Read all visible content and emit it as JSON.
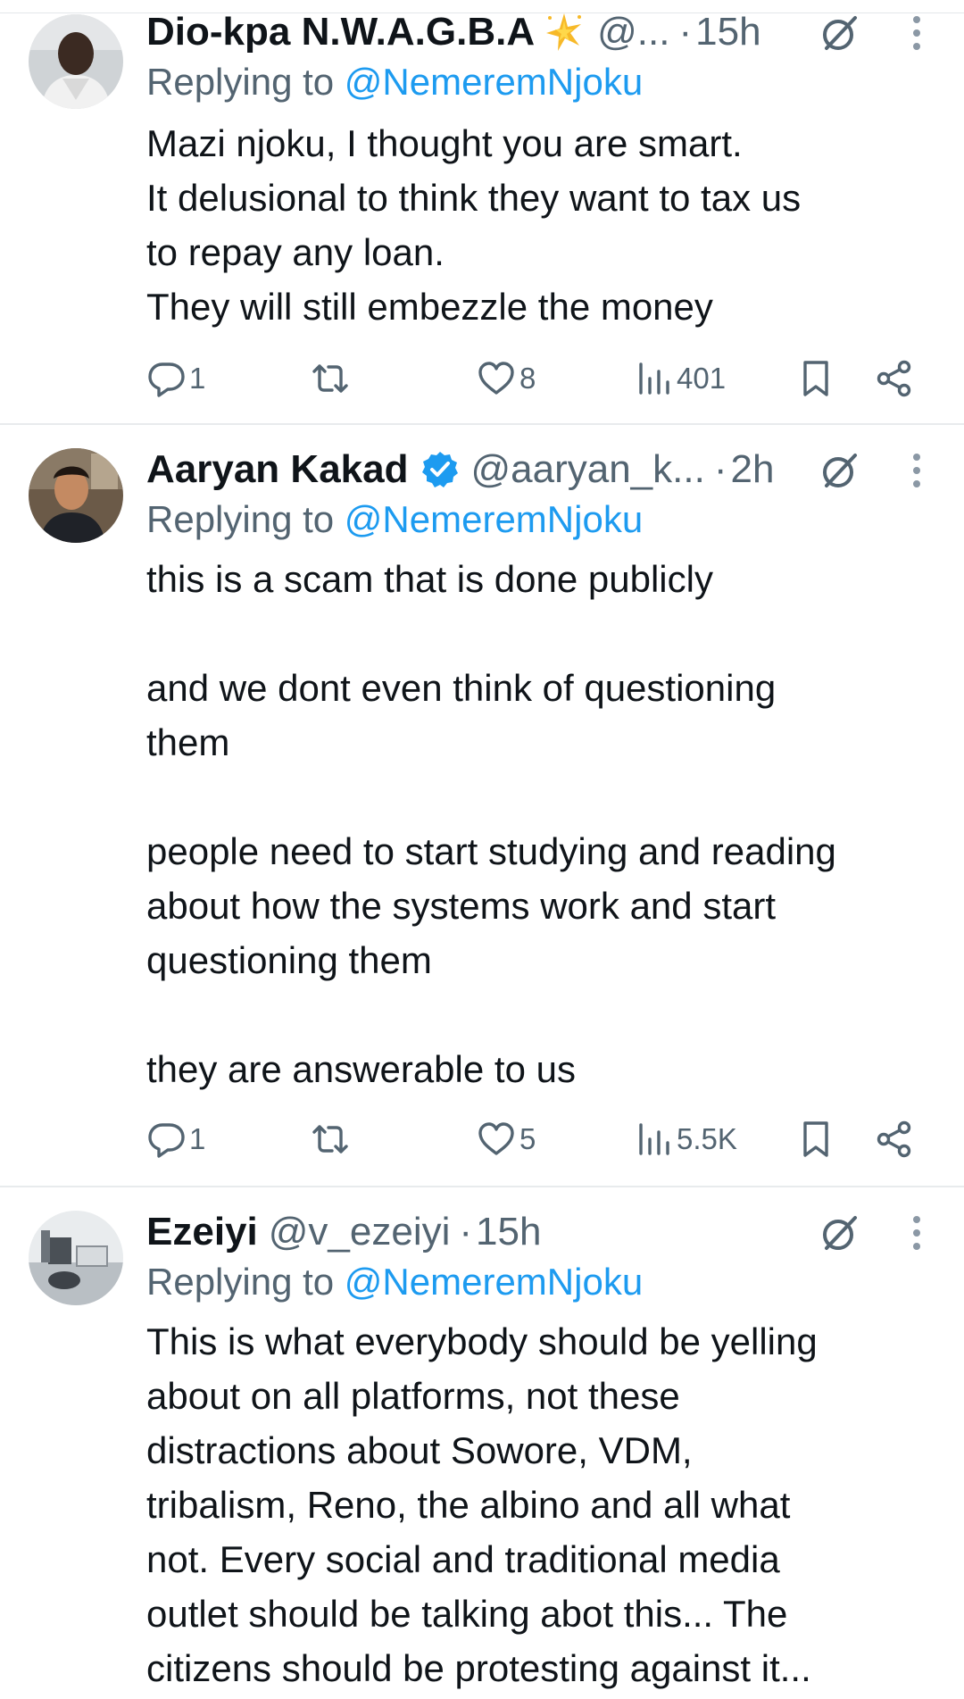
{
  "replies": [
    {
      "name": "Dio-kpa N.W.A.G.B.A",
      "name_emoji": "sparkle-star",
      "verified": false,
      "handle": "@...",
      "time": "15h",
      "replying_prefix": "Replying to",
      "replying_to": "@NemeremNjoku",
      "lines": [
        "Mazi njoku, I thought you are smart.",
        "It delusional to think they want to tax us",
        "to repay any loan.",
        "They will still embezzle the money"
      ],
      "stats": {
        "replies": "1",
        "reposts": "",
        "likes": "8",
        "views": "401"
      }
    },
    {
      "name": "Aaryan Kakad",
      "verified": true,
      "handle": "@aaryan_k...",
      "time": "2h",
      "replying_prefix": "Replying to",
      "replying_to": "@NemeremNjoku",
      "lines": [
        "this is a scam that is done publicly",
        "",
        "and we dont even think of questioning",
        "them",
        "",
        "people need to start studying and reading",
        "about how the systems work and start",
        "questioning them",
        "",
        "they are answerable to us"
      ],
      "stats": {
        "replies": "1",
        "reposts": "",
        "likes": "5",
        "views": "5.5K"
      }
    },
    {
      "name": "Ezeiyi",
      "verified": false,
      "handle": "@v_ezeiyi",
      "time": "15h",
      "replying_prefix": "Replying to",
      "replying_to": "@NemeremNjoku",
      "lines": [
        "This is what everybody should be yelling",
        "about on all platforms, not these",
        "distractions about Sowore, VDM,",
        "tribalism, Reno, the albino and all what",
        "not. Every social and traditional media",
        "outlet should be talking abot this... The",
        "citizens should be protesting against it..."
      ]
    }
  ],
  "colors": {
    "link": "#1d9bf0",
    "secondary_text": "#536471",
    "primary_text": "#0f1419",
    "verified_badge": "#1d9bf0",
    "divider": "#e8ebed"
  },
  "icons": [
    "reply-icon",
    "repost-icon",
    "like-icon",
    "views-icon",
    "bookmark-icon",
    "share-icon",
    "grok-icon",
    "more-icon",
    "verified-badge-icon",
    "sparkle-star-emoji"
  ]
}
